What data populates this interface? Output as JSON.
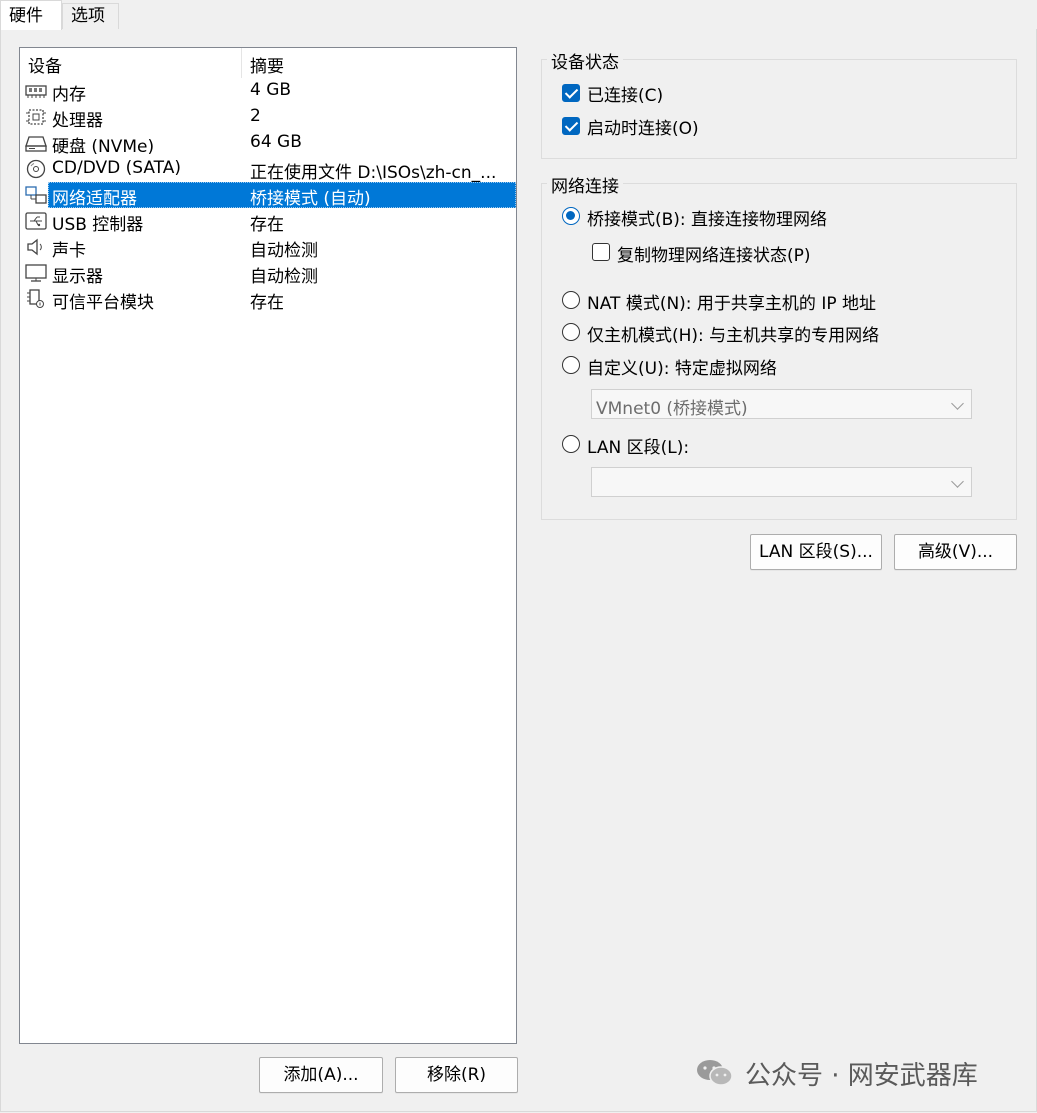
{
  "tabs": [
    {
      "label": "硬件",
      "active": true
    },
    {
      "label": "选项",
      "active": false
    }
  ],
  "device_list": {
    "headers": {
      "device": "设备",
      "summary": "摘要"
    },
    "rows": [
      {
        "icon": "memory-icon",
        "name": "内存",
        "summary": "4 GB"
      },
      {
        "icon": "processor-icon",
        "name": "处理器",
        "summary": "2"
      },
      {
        "icon": "hard-disk-icon",
        "name": "硬盘 (NVMe)",
        "summary": "64 GB"
      },
      {
        "icon": "cd-dvd-icon",
        "name": "CD/DVD (SATA)",
        "summary": "正在使用文件 D:\\ISOs\\zh-cn_..."
      },
      {
        "icon": "network-adapter-icon",
        "name": "网络适配器",
        "summary": "桥接模式 (自动)",
        "selected": true
      },
      {
        "icon": "usb-icon",
        "name": "USB 控制器",
        "summary": "存在"
      },
      {
        "icon": "sound-card-icon",
        "name": "声卡",
        "summary": "自动检测"
      },
      {
        "icon": "display-icon",
        "name": "显示器",
        "summary": "自动检测"
      },
      {
        "icon": "tpm-icon",
        "name": "可信平台模块",
        "summary": "存在"
      }
    ]
  },
  "buttons": {
    "add": "添加(A)...",
    "remove": "移除(R)",
    "lan_segments": "LAN 区段(S)...",
    "advanced": "高级(V)..."
  },
  "device_status": {
    "title": "设备状态",
    "connected": {
      "label": "已连接(C)",
      "checked": true
    },
    "connect_at_power_on": {
      "label": "启动时连接(O)",
      "checked": true
    }
  },
  "network_connection": {
    "title": "网络连接",
    "bridged": {
      "label": "桥接模式(B): 直接连接物理网络",
      "selected": true
    },
    "replicate": {
      "label": "复制物理网络连接状态(P)",
      "checked": false
    },
    "nat": {
      "label": "NAT 模式(N): 用于共享主机的 IP 地址",
      "selected": false
    },
    "host_only": {
      "label": "仅主机模式(H): 与主机共享的专用网络",
      "selected": false
    },
    "custom": {
      "label": "自定义(U): 特定虚拟网络",
      "selected": false
    },
    "custom_value": "VMnet0 (桥接模式)",
    "lan_segment": {
      "label": "LAN 区段(L):",
      "selected": false
    },
    "lan_segment_value": ""
  },
  "watermark": {
    "text": "公众号 · 网安武器库",
    "icon": "wechat-icon"
  },
  "colors": {
    "selection": "#0078d7",
    "accent": "#0067c0"
  }
}
